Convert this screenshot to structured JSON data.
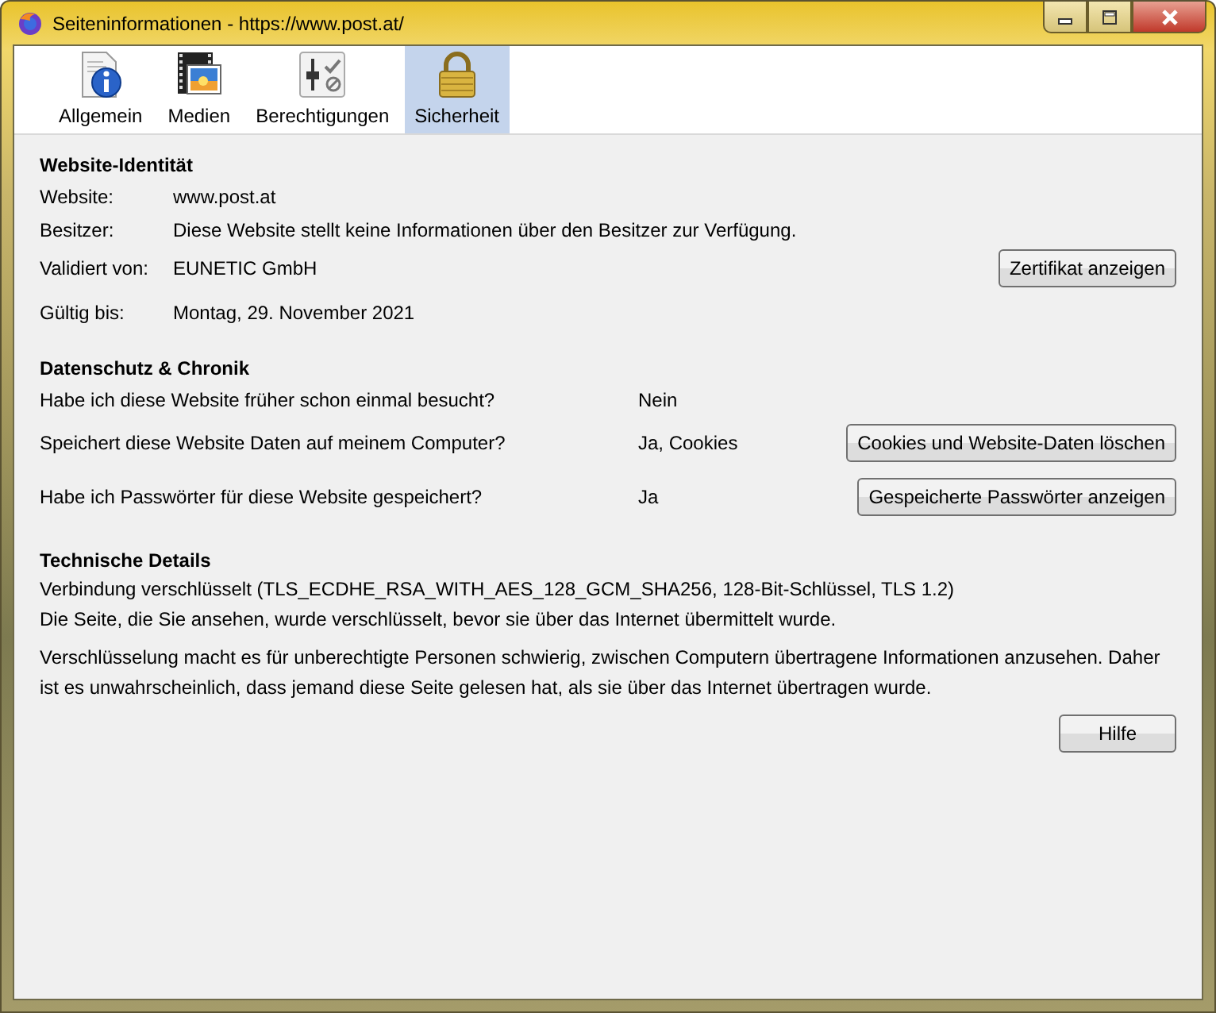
{
  "window": {
    "title": "Seiteninformationen - https://www.post.at/"
  },
  "tabs": [
    {
      "label": "Allgemein",
      "kind": "info",
      "selected": false
    },
    {
      "label": "Medien",
      "kind": "media",
      "selected": false
    },
    {
      "label": "Berechtigungen",
      "kind": "permissions",
      "selected": false
    },
    {
      "label": "Sicherheit",
      "kind": "security",
      "selected": true
    }
  ],
  "identity": {
    "heading": "Website-Identität",
    "rows": [
      {
        "label": "Website:",
        "value": "www.post.at"
      },
      {
        "label": "Besitzer:",
        "value": "Diese Website stellt keine Informationen über den Besitzer zur Verfügung."
      },
      {
        "label": "Validiert von:",
        "value": "EUNETIC GmbH",
        "button": "Zertifikat anzeigen"
      },
      {
        "label": "Gültig bis:",
        "value": "Montag, 29. November 2021"
      }
    ]
  },
  "privacy": {
    "heading": "Datenschutz & Chronik",
    "rows": [
      {
        "question": "Habe ich diese Website früher schon einmal besucht?",
        "answer": "Nein"
      },
      {
        "question": "Speichert diese Website Daten auf meinem Computer?",
        "answer": "Ja, Cookies",
        "button": "Cookies und Website-Daten löschen"
      },
      {
        "question": "Habe ich Passwörter für diese Website gespeichert?",
        "answer": "Ja",
        "button": "Gespeicherte Passwörter anzeigen"
      }
    ]
  },
  "technical": {
    "heading": "Technische Details",
    "lines": [
      "Verbindung verschlüsselt (TLS_ECDHE_RSA_WITH_AES_128_GCM_SHA256, 128-Bit-Schlüssel, TLS 1.2)",
      "Die Seite, die Sie ansehen, wurde verschlüsselt, bevor sie über das Internet übermittelt wurde.",
      "Verschlüsselung macht es für unberechtigte Personen schwierig, zwischen Computern übertragene Informationen anzusehen. Daher ist es unwahrscheinlich, dass jemand diese Seite gelesen hat, als sie über das Internet übertragen wurde."
    ]
  },
  "help_button": "Hilfe"
}
